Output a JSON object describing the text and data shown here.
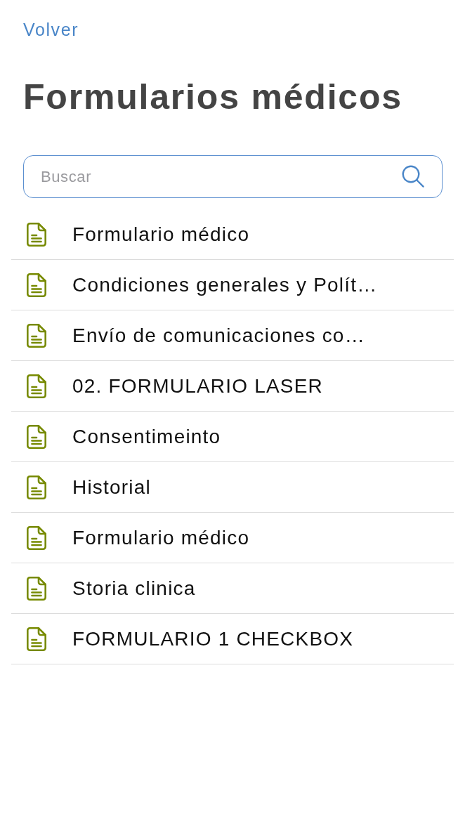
{
  "back_link": {
    "label": "Volver"
  },
  "title": "Formularios médicos",
  "search": {
    "placeholder": "Buscar"
  },
  "forms": [
    {
      "label": "Formulario médico"
    },
    {
      "label": "Condiciones generales y Polít…"
    },
    {
      "label": "Envío de comunicaciones co…"
    },
    {
      "label": "02. FORMULARIO LASER"
    },
    {
      "label": "Consentimeinto"
    },
    {
      "label": "Historial"
    },
    {
      "label": "Formulario médico"
    },
    {
      "label": "Storia clinica"
    },
    {
      "label": "FORMULARIO 1 CHECKBOX"
    }
  ]
}
